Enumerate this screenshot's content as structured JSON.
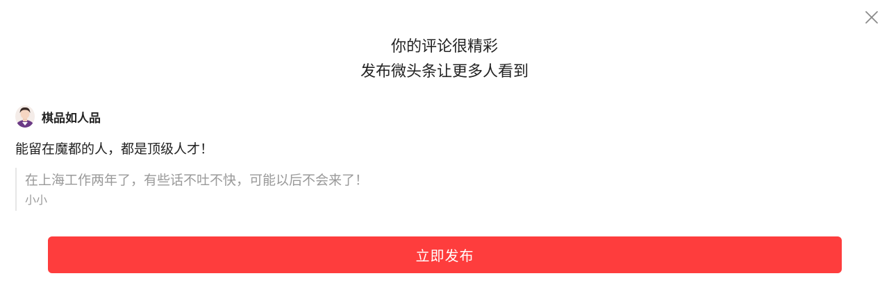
{
  "dialog": {
    "title_line1": "你的评论很精彩",
    "title_line2": "发布微头条让更多人看到",
    "close_icon": "close-icon"
  },
  "author": {
    "name": "棋品如人品",
    "avatar_icon": "user-avatar"
  },
  "comment": {
    "text": "能留在魔都的人，都是顶级人才！"
  },
  "quoted_article": {
    "title": "在上海工作两年了，有些话不吐不快，可能以后不会来了！",
    "author": "小小"
  },
  "actions": {
    "publish_label": "立即发布"
  },
  "colors": {
    "accent": "#fe3d3d",
    "muted_text": "#999999",
    "text": "#222222"
  }
}
